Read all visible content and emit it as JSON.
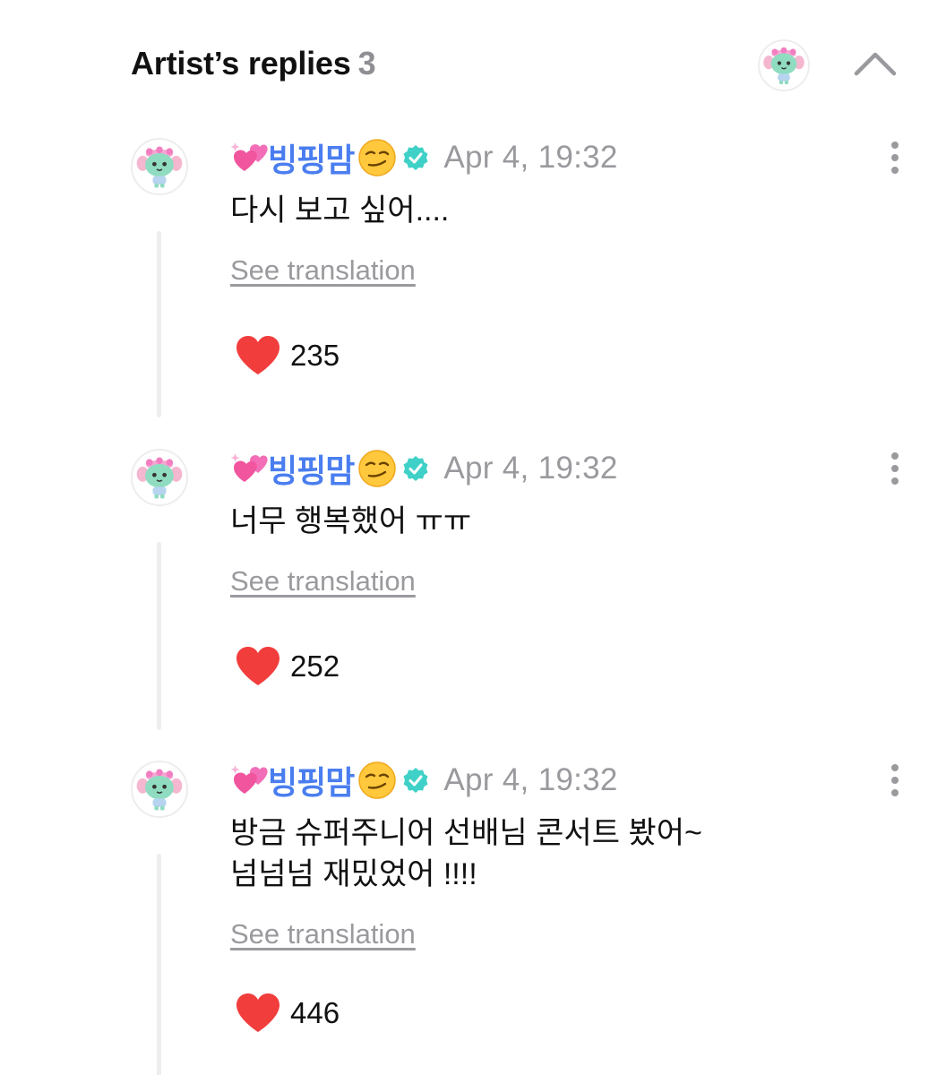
{
  "header": {
    "title": "Artist’s replies",
    "count": "3"
  },
  "colors": {
    "username": "#4a7ef0",
    "muted": "#9a9a9e",
    "heart": "#f23d3d",
    "verified": "#3fd1c7"
  },
  "icons": {
    "collapse": "chevron-up-icon",
    "more": "more-vertical-icon",
    "like": "heart-icon",
    "verified": "verified-badge-icon",
    "username_prefix": "sparkling-hearts-emoji",
    "username_suffix": "smirking-face-emoji"
  },
  "replies": [
    {
      "username": "빙핑맘",
      "timestamp": "Apr 4, 19:32",
      "text_lines": [
        "다시 보고 싶어...."
      ],
      "see_translation": "See translation",
      "likes": "235"
    },
    {
      "username": "빙핑맘",
      "timestamp": "Apr 4, 19:32",
      "text_lines": [
        "너무 행복했어 ㅠㅠ"
      ],
      "see_translation": "See translation",
      "likes": "252"
    },
    {
      "username": "빙핑맘",
      "timestamp": "Apr 4, 19:32",
      "text_lines": [
        "방금 슈퍼주니어 선배님 콘서트 봤어~",
        "넘넘넘 재밌었어 !!!!"
      ],
      "see_translation": "See translation",
      "likes": "446"
    }
  ]
}
